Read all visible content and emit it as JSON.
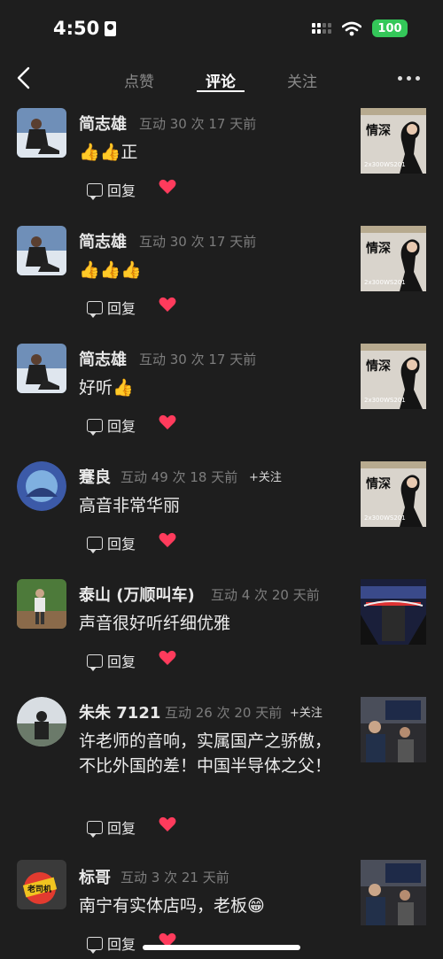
{
  "status_bar": {
    "time": "4:50",
    "battery": "100"
  },
  "nav": {
    "tabs": [
      "点赞",
      "评论",
      "关注"
    ],
    "active_tab": "评论"
  },
  "common": {
    "reply_label": "回复",
    "follow_label": "+关注"
  },
  "comments": [
    {
      "name": "简志雄",
      "meta": "互动 30 次  17 天前",
      "content": "👍👍正",
      "follow": false
    },
    {
      "name": "简志雄",
      "meta": "互动 30 次  17 天前",
      "content": "👍👍👍",
      "follow": false
    },
    {
      "name": "简志雄",
      "meta": "互动 30 次  17 天前",
      "content": "好听👍",
      "follow": false
    },
    {
      "name": "蹇良",
      "meta": "互动 49 次  18 天前",
      "content": "高音非常华丽",
      "follow": true
    },
    {
      "name": "泰山 (万顺叫车)",
      "meta": "互动 4 次  20 天前",
      "content": "声音很好听纤细优雅",
      "follow": false
    },
    {
      "name": "朱朱 7121",
      "meta": "互动 26 次  20 天前",
      "content": "许老师的音响，实属国产之骄傲，不比外国的差！中国半导体之父！",
      "follow": true
    },
    {
      "name": "标哥",
      "meta": "互动 3 次  21 天前",
      "content": "南宁有实体店吗，老板😁",
      "follow": false
    }
  ],
  "album_art": {
    "title": "情深",
    "subtitle": "2x300WS201"
  },
  "avatar_badge": "老司机",
  "colors": {
    "background": "#1e1e1e",
    "heart": "#ff3b5c",
    "battery": "#34c759"
  }
}
